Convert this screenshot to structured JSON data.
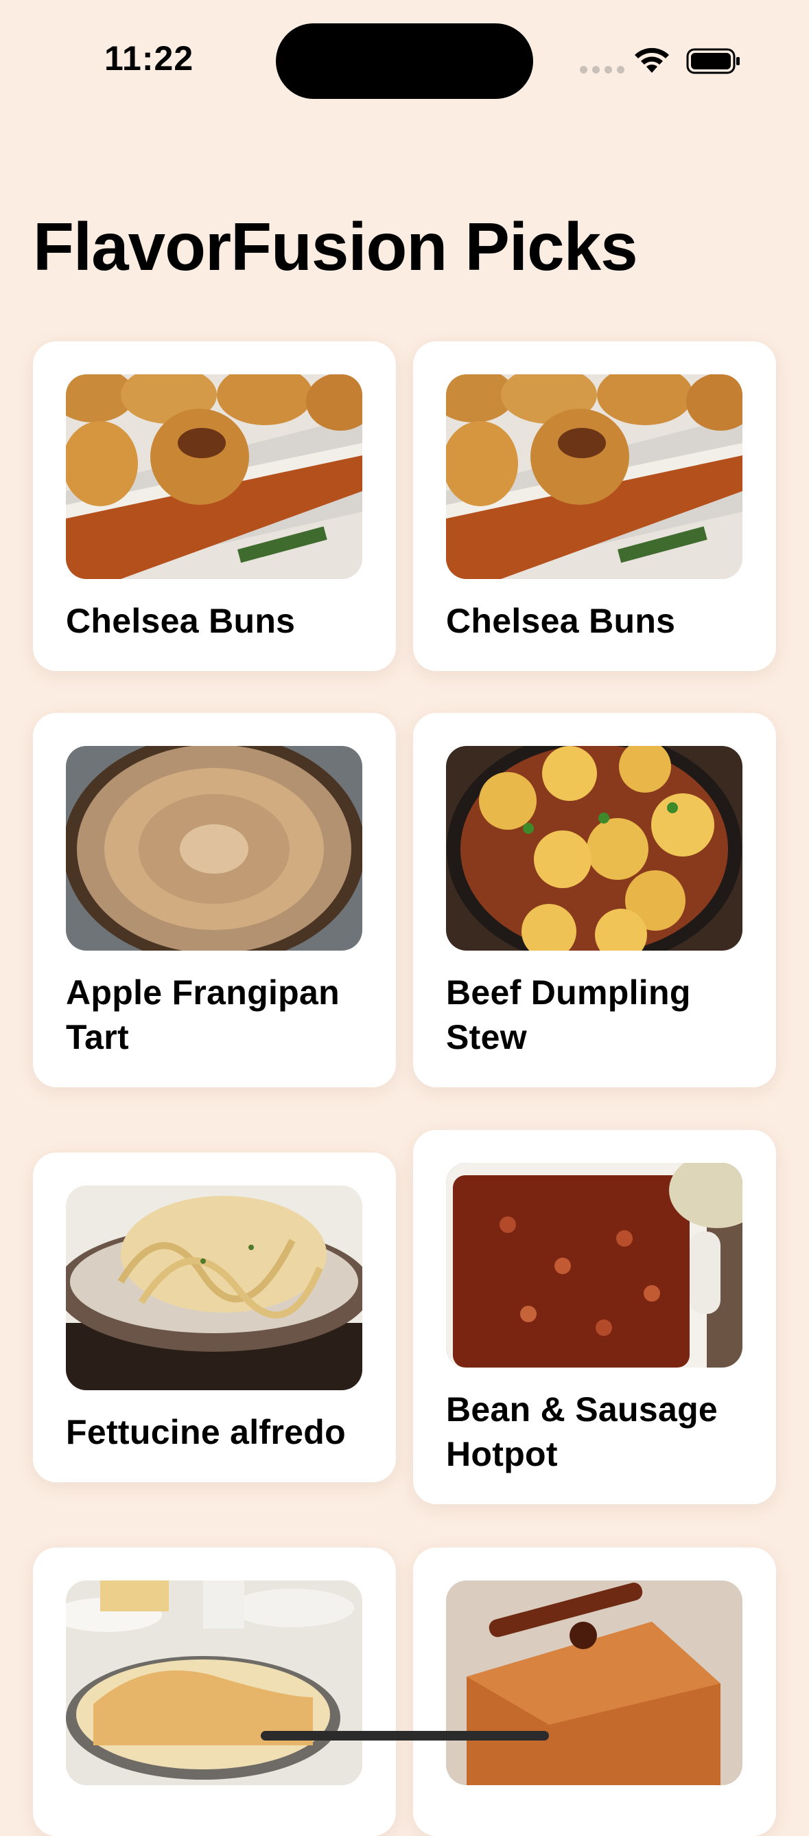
{
  "status_bar": {
    "time": "11:22"
  },
  "title": "FlavorFusion Picks",
  "recipes": [
    {
      "name": "Chelsea Buns",
      "image": "chelsea-buns"
    },
    {
      "name": "Chelsea Buns",
      "image": "chelsea-buns"
    },
    {
      "name": "Apple Frangipan Tart",
      "image": "apple-tart"
    },
    {
      "name": "Beef Dumpling Stew",
      "image": "dumpling-stew"
    },
    {
      "name": "Fettucine alfredo",
      "image": "fettucine"
    },
    {
      "name": "Bean & Sausage Hotpot",
      "image": "bean-hotpot"
    },
    {
      "name": "",
      "image": "pie"
    },
    {
      "name": "",
      "image": "syrup-cake"
    }
  ]
}
